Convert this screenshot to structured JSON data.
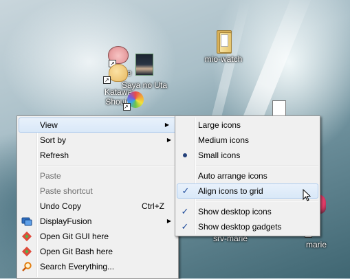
{
  "desktop": {
    "icons": [
      {
        "label": "mio-watch"
      },
      {
        "label": "rite"
      },
      {
        "label": "Saya no Uta"
      },
      {
        "label": "Katawa Shoujo"
      },
      {
        "label": "srv-marie"
      },
      {
        "label": "marie"
      }
    ]
  },
  "context_menu": {
    "items": [
      {
        "label": "View",
        "has_submenu": true
      },
      {
        "label": "Sort by",
        "has_submenu": true
      },
      {
        "label": "Refresh"
      },
      {
        "label": "Paste",
        "disabled": true
      },
      {
        "label": "Paste shortcut",
        "disabled": true
      },
      {
        "label": "Undo Copy",
        "shortcut": "Ctrl+Z"
      },
      {
        "label": "DisplayFusion",
        "has_submenu": true,
        "icon": "displayfusion-icon"
      },
      {
        "label": "Open Git GUI here",
        "icon": "git-icon"
      },
      {
        "label": "Open Git Bash here",
        "icon": "git-icon"
      },
      {
        "label": "Search Everything...",
        "icon": "magnifier-icon"
      }
    ],
    "arrow_glyph": "▶"
  },
  "view_submenu": {
    "items": [
      {
        "label": "Large icons"
      },
      {
        "label": "Medium icons"
      },
      {
        "label": "Small icons",
        "selected": true
      },
      {
        "label": "Auto arrange icons"
      },
      {
        "label": "Align icons to grid",
        "checked": true
      },
      {
        "label": "Show desktop icons",
        "checked": true
      },
      {
        "label": "Show desktop gadgets",
        "checked": true
      }
    ],
    "check_glyph": "✓"
  },
  "colors": {
    "menu_bg": "#f0f0f0",
    "hover_bg": "#d9e8f8",
    "hover_border": "#aeccef",
    "check": "#1d4a9a"
  }
}
